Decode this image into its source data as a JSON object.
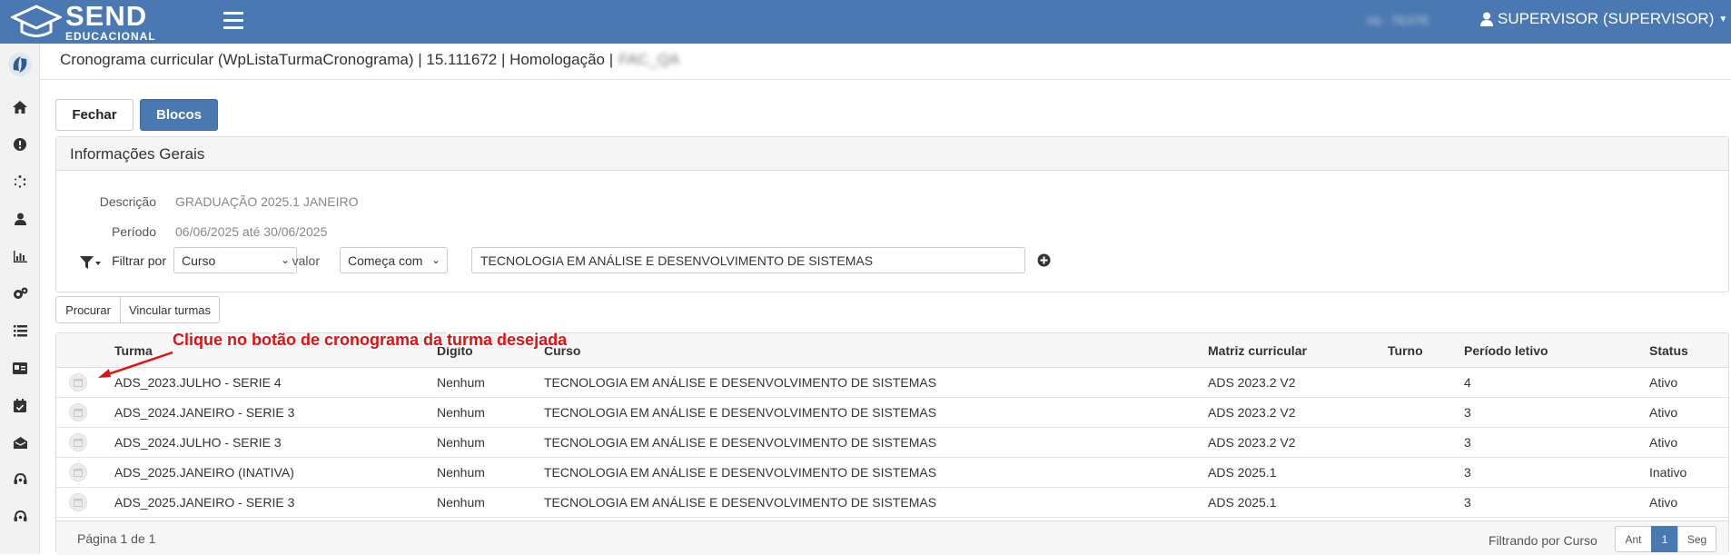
{
  "app": {
    "logo_text": "SEND",
    "logo_subtext": "EDUCACIONAL",
    "environment": "(4) - TESTE",
    "user": "SUPERVISOR (SUPERVISOR)"
  },
  "sidebar": {
    "icons": [
      "home-icon",
      "alert-icon",
      "spinner-icon",
      "user-icon",
      "chart-icon",
      "gears-icon",
      "list-icon",
      "id-card-icon",
      "calendar-check-icon",
      "inbox-icon",
      "headset-icon",
      "headset-icon"
    ]
  },
  "breadcrumb": {
    "text": "Cronograma curricular (WpListaTurmaCronograma) | 15.111672 | Homologação |",
    "tail": "FAC_QA"
  },
  "actions": {
    "fechar": "Fechar",
    "blocos": "Blocos"
  },
  "panel": {
    "title": "Informações Gerais",
    "descricao_label": "Descrição",
    "descricao_value": "GRADUAÇÃO 2025.1 JANEIRO",
    "periodo_label": "Período",
    "periodo_value": "06/06/2025 até 30/06/2025",
    "filtrar_label": "Filtrar por",
    "filtrar_value": "Curso",
    "valor_label": "valor",
    "operador_value": "Começa com",
    "search_value": "TECNOLOGIA EM ANÁLISE E DESENVOLVIMENTO DE SISTEMAS"
  },
  "buttons": {
    "procurar": "Procurar",
    "vincular": "Vincular turmas"
  },
  "table": {
    "columns": {
      "turma": "Turma",
      "digito": "Dígito",
      "curso": "Curso",
      "matriz": "Matriz curricular",
      "turno": "Turno",
      "periodo": "Período letivo",
      "status": "Status"
    },
    "rows": [
      {
        "turma": "ADS_2023.JULHO - SERIE 4",
        "digito": "Nenhum",
        "curso": "TECNOLOGIA EM ANÁLISE E DESENVOLVIMENTO DE SISTEMAS",
        "matriz": "ADS 2023.2 V2",
        "turno": "",
        "periodo": "4",
        "status": "Ativo"
      },
      {
        "turma": "ADS_2024.JANEIRO - SERIE 3",
        "digito": "Nenhum",
        "curso": "TECNOLOGIA EM ANÁLISE E DESENVOLVIMENTO DE SISTEMAS",
        "matriz": "ADS 2023.2 V2",
        "turno": "",
        "periodo": "3",
        "status": "Ativo"
      },
      {
        "turma": "ADS_2024.JULHO - SERIE 3",
        "digito": "Nenhum",
        "curso": "TECNOLOGIA EM ANÁLISE E DESENVOLVIMENTO DE SISTEMAS",
        "matriz": "ADS 2023.2 V2",
        "turno": "",
        "periodo": "3",
        "status": "Ativo"
      },
      {
        "turma": "ADS_2025.JANEIRO (INATIVA)",
        "digito": "Nenhum",
        "curso": "TECNOLOGIA EM ANÁLISE E DESENVOLVIMENTO DE SISTEMAS",
        "matriz": "ADS 2025.1",
        "turno": "",
        "periodo": "3",
        "status": "Inativo"
      },
      {
        "turma": "ADS_2025.JANEIRO - SERIE 3",
        "digito": "Nenhum",
        "curso": "TECNOLOGIA EM ANÁLISE E DESENVOLVIMENTO DE SISTEMAS",
        "matriz": "ADS 2025.1",
        "turno": "",
        "periodo": "3",
        "status": "Ativo"
      }
    ],
    "footer": {
      "page_info": "Página 1 de 1",
      "filter_info": "Filtrando por Curso",
      "prev": "Ant",
      "current": "1",
      "next": "Seg"
    }
  },
  "annotation": {
    "text": "Clique no botão de cronograma da turma desejada",
    "color": "#e01010"
  },
  "colors": {
    "brand": "#4a78b0"
  }
}
